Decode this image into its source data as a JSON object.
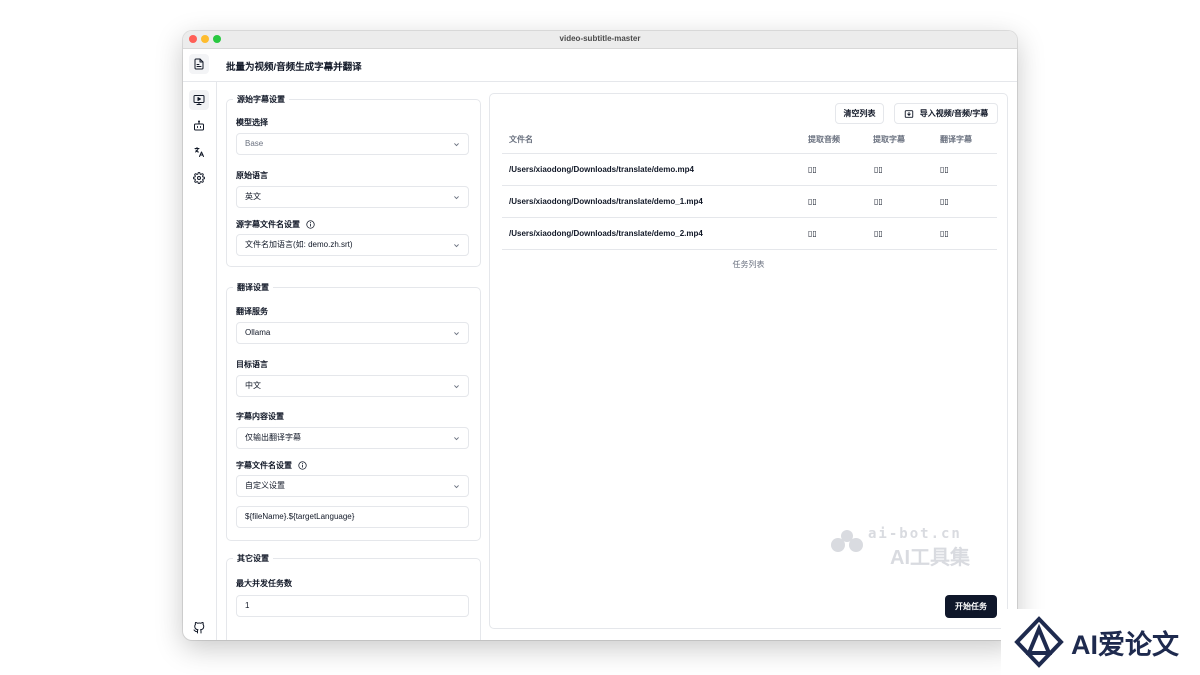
{
  "window": {
    "title": "video-subtitle-master"
  },
  "header": {
    "title": "批量为视频/音频生成字幕并翻译",
    "icon": "file-subtitle-icon"
  },
  "sidebar": {
    "items": [
      {
        "name": "media-icon",
        "active": true
      },
      {
        "name": "bot-icon",
        "active": false
      },
      {
        "name": "translate-icon",
        "active": false
      },
      {
        "name": "gear-icon",
        "active": false
      }
    ],
    "footer_icon": "github-icon"
  },
  "source_settings": {
    "legend": "源始字幕设置",
    "model_label": "模型选择",
    "model_value": "Base",
    "language_label": "原始语言",
    "language_value": "英文",
    "filename_label": "源字幕文件名设置",
    "filename_value": "文件名加语言(如: demo.zh.srt)"
  },
  "translate_settings": {
    "legend": "翻译设置",
    "service_label": "翻译服务",
    "service_value": "Ollama",
    "target_label": "目标语言",
    "target_value": "中文",
    "content_label": "字幕内容设置",
    "content_value": "仅输出翻译字幕",
    "filename_label": "字幕文件名设置",
    "filename_value": "自定义设置",
    "template_value": "${fileName}.${targetLanguage}"
  },
  "other_settings": {
    "legend": "其它设置",
    "concurrency_label": "最大并发任务数",
    "concurrency_value": "1"
  },
  "task_panel": {
    "clear_label": "清空列表",
    "import_label": "导入视频/音频/字幕",
    "columns": {
      "file": "文件名",
      "extract_audio": "提取音频",
      "extract_subtitle": "提取字幕",
      "translate_subtitle": "翻译字幕"
    },
    "rows": [
      {
        "file": "/Users/xiaodong/Downloads/translate/demo.mp4",
        "audio": "▯▯",
        "subtitle": "▯▯",
        "translate": "▯▯"
      },
      {
        "file": "/Users/xiaodong/Downloads/translate/demo_1.mp4",
        "audio": "▯▯",
        "subtitle": "▯▯",
        "translate": "▯▯"
      },
      {
        "file": "/Users/xiaodong/Downloads/translate/demo_2.mp4",
        "audio": "▯▯",
        "subtitle": "▯▯",
        "translate": "▯▯"
      }
    ],
    "caption": "任务列表",
    "start_label": "开始任务"
  },
  "watermarks": {
    "site_url": "ai-bot.cn",
    "site_name": "AI工具集",
    "corner_brand": "AI爱论文"
  },
  "colors": {
    "primary_button": "#0f172a",
    "border": "#e5e7eb",
    "muted_text": "#6b7280"
  }
}
